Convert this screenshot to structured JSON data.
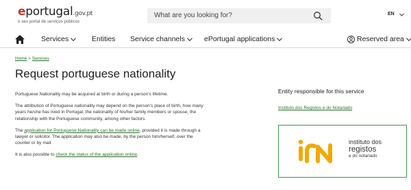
{
  "header": {
    "logo_e": "e",
    "logo_word": "portugal",
    "logo_gov": ".gov.pt",
    "logo_tagline": "o seu portal de serviços públicos",
    "search_placeholder": "What are you looking for?",
    "language": "EN"
  },
  "nav": {
    "items": [
      {
        "label": "Services"
      },
      {
        "label": "Entities"
      },
      {
        "label": "Service channels"
      },
      {
        "label": "ePortugal applications"
      }
    ],
    "reserved_area": "Reserved area"
  },
  "breadcrumb": {
    "home": "Home",
    "separator": ">",
    "services": "Services"
  },
  "page_title": "Request portuguese nationality",
  "content": {
    "p1": "Portuguese Nationality may be acquired at birth or during a person's lifetime.",
    "p2": "The attribution of Portuguese nationality may depend on the person's place of birth, how many years he/she has lived in Portugal, the nationality of his/her family members or spouse, the relationship with the Portuguese community, among other factors.",
    "p3_prefix": "The ",
    "p3_link": "application for Portuguese Nationality can be made online",
    "p3_suffix": ", provided it is made through a lawyer or solicitor. The application may also be made, by the person him/herself, over the counter or by mail.",
    "p4_prefix": "It is also possible to ",
    "p4_link": "check the status of the application online",
    "p4_suffix": "."
  },
  "aside": {
    "title": "Entity responsible for this service",
    "entity_link": "Instituto dos Registos e do Notariado",
    "logo_line1": "instituto dos",
    "logo_line2": "registos",
    "logo_line3": "e do notariado"
  },
  "colors": {
    "accent_red": "#d0342c",
    "link_green": "#2a6f2a",
    "logo_orange": "#f2a900",
    "border_green": "#3a9a4a"
  }
}
